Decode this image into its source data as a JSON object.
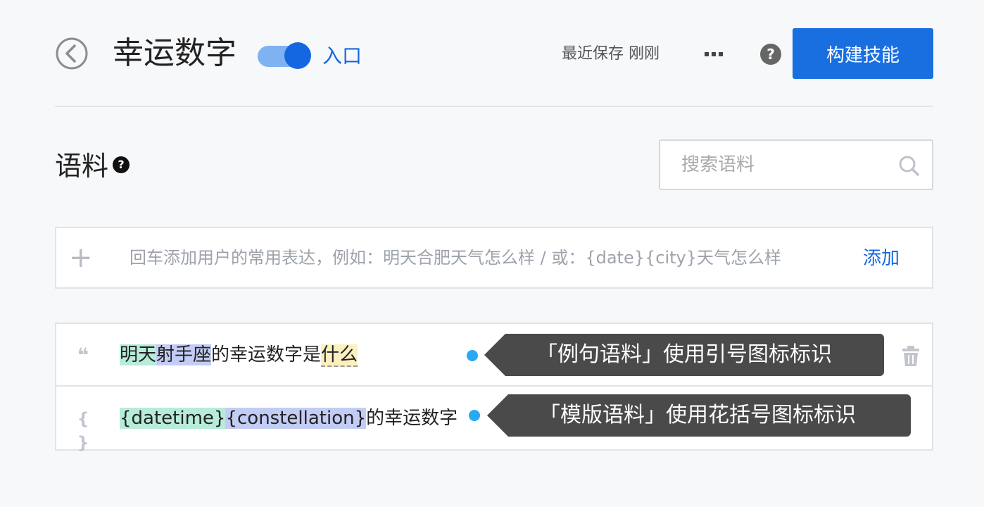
{
  "header": {
    "title": "幸运数字",
    "entry_label": "入口",
    "saved_status": "最近保存 刚刚",
    "help_glyph": "?",
    "build_button": "构建技能"
  },
  "corpus": {
    "title": "语料",
    "help_glyph": "?",
    "search_placeholder": "搜索语料",
    "add_placeholder": "回车添加用户的常用表达，例如：明天合肥天气怎么样 / 或：{date}{city}天气怎么样",
    "add_link": "添加",
    "rows": [
      {
        "icon": "❝",
        "segments": [
          "明天",
          "射手座",
          "的幸运数字是",
          "什么"
        ]
      },
      {
        "icon": "{ }",
        "segments": [
          "{datetime}",
          "{constellation}",
          "的幸运数字"
        ]
      }
    ]
  },
  "tooltips": {
    "example": "「例句语料」使用引号图标标识",
    "template": "「模版语料」使用花括号图标标识"
  },
  "colors": {
    "accent": "#1a6fe0",
    "toggle_track": "#7fb2f0",
    "highlight_green": "#b7ecd9",
    "highlight_blue": "#c2ccf5",
    "highlight_yellow": "#fcf0c0",
    "tooltip_bg": "#4a4a4a",
    "dot": "#2aa8f2"
  }
}
